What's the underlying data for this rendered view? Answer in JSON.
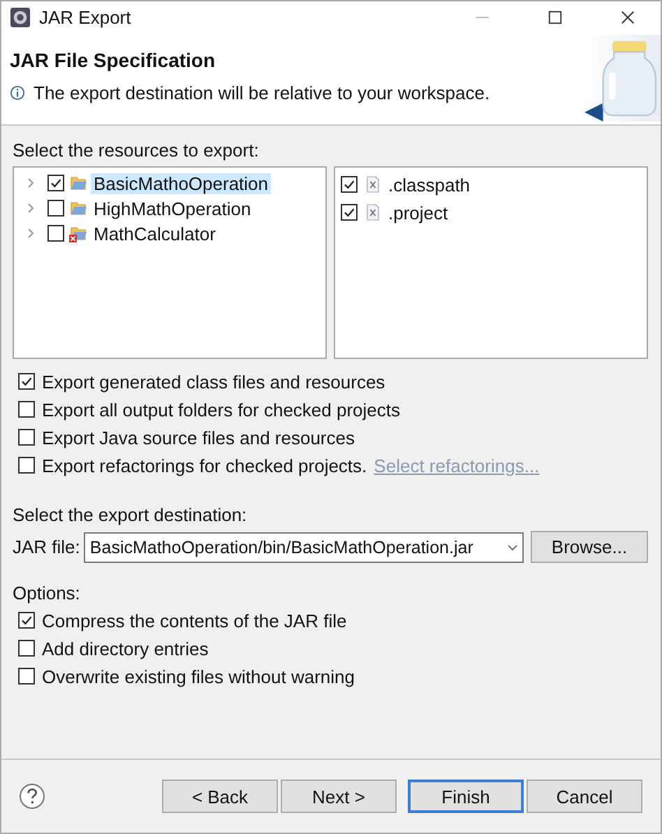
{
  "window": {
    "title": "JAR Export"
  },
  "header": {
    "title": "JAR File Specification",
    "message": "The export destination will be relative to your workspace."
  },
  "resources": {
    "label": "Select the resources to export:",
    "projects": [
      {
        "name": "BasicMathoOperation",
        "checked": true,
        "selected": true,
        "error": false,
        "expanded": false
      },
      {
        "name": "HighMathOperation",
        "checked": false,
        "selected": false,
        "error": false,
        "expanded": false
      },
      {
        "name": "MathCalculator",
        "checked": false,
        "selected": false,
        "error": true,
        "expanded": false
      }
    ],
    "files": [
      {
        "name": ".classpath",
        "checked": true
      },
      {
        "name": ".project",
        "checked": true
      }
    ]
  },
  "export_options": [
    {
      "label": "Export generated class files and resources",
      "checked": true
    },
    {
      "label": "Export all output folders for checked projects",
      "checked": false
    },
    {
      "label": "Export Java source files and resources",
      "checked": false
    },
    {
      "label": "Export refactorings for checked projects.",
      "checked": false,
      "link": "Select refactorings..."
    }
  ],
  "destination": {
    "label": "Select the export destination:",
    "field_label": "JAR file:",
    "value": "BasicMathoOperation/bin/BasicMathOperation.jar",
    "browse": "Browse..."
  },
  "options": {
    "label": "Options:",
    "items": [
      {
        "label": "Compress the contents of the JAR file",
        "checked": true
      },
      {
        "label": "Add directory entries",
        "checked": false
      },
      {
        "label": "Overwrite existing files without warning",
        "checked": false
      }
    ]
  },
  "buttons": [
    {
      "label": "< Back",
      "default": false
    },
    {
      "label": "Next >",
      "default": false
    },
    {
      "label": "Finish",
      "default": true
    },
    {
      "label": "Cancel",
      "default": false
    }
  ]
}
